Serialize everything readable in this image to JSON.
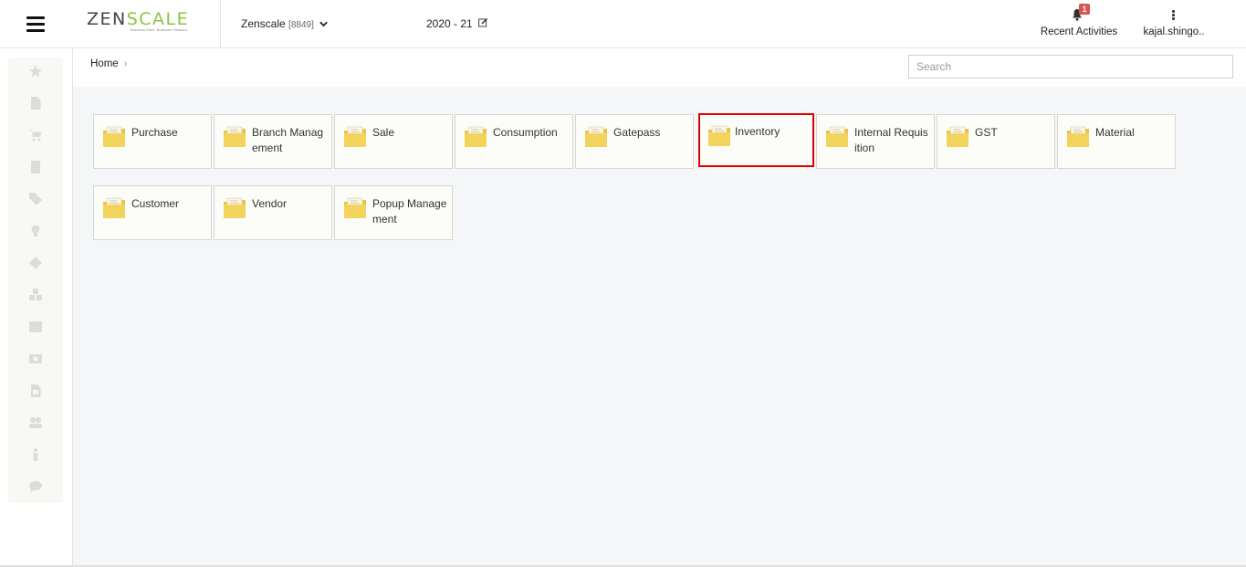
{
  "header": {
    "logo": {
      "text_a": "ZEN",
      "text_b": "SCALE",
      "tagline": "Business Ease. Business Pleasure."
    },
    "company": {
      "name": "Zenscale",
      "code": "[8849]"
    },
    "financial_year": "2020 - 21",
    "recent_activities": {
      "label": "Recent Activities",
      "badge": "1"
    },
    "user": {
      "name": "kajal.shingo.."
    }
  },
  "sidebar": {
    "icons": [
      "star-icon",
      "document-icon",
      "cart-icon",
      "book-icon",
      "tag-icon",
      "lightbulb-icon",
      "ticket-icon",
      "cubes-icon",
      "grid-icon",
      "money-icon",
      "file-icon",
      "users-icon",
      "person-icon",
      "chat-icon"
    ]
  },
  "breadcrumb": {
    "home": "Home",
    "separator": "›"
  },
  "search": {
    "placeholder": "Search",
    "value": ""
  },
  "modules": [
    {
      "label": "Purchase",
      "selected": false
    },
    {
      "label": "Branch Management",
      "selected": false
    },
    {
      "label": "Sale",
      "selected": false
    },
    {
      "label": "Consumption",
      "selected": false
    },
    {
      "label": "Gatepass",
      "selected": false
    },
    {
      "label": "Inventory",
      "selected": true
    },
    {
      "label": "Internal Requisition",
      "selected": false
    },
    {
      "label": "GST",
      "selected": false
    },
    {
      "label": "Material",
      "selected": false
    },
    {
      "label": "Customer",
      "selected": false
    },
    {
      "label": "Vendor",
      "selected": false
    },
    {
      "label": "Popup Management",
      "selected": false
    }
  ],
  "colors": {
    "brand_green": "#8cc63f",
    "folder_yellow": "#f2d35c",
    "selected_border": "#e00000",
    "badge_red": "#d9534f"
  }
}
